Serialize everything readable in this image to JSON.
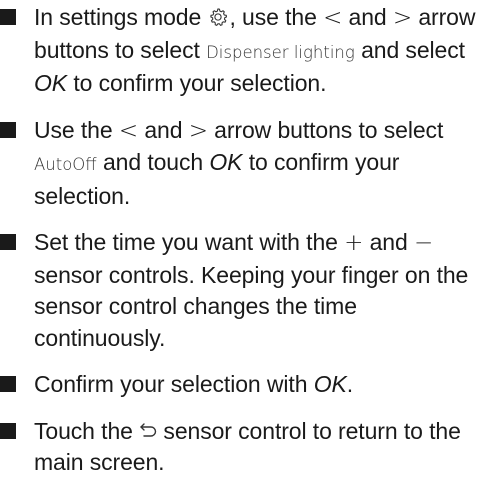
{
  "steps": [
    {
      "t1": "In settings mode ",
      "gear_icon": "gear-icon",
      "t2": ", use the ",
      "lt": "<",
      "t3": " and ",
      "gt": ">",
      "t4": " arrow buttons to select ",
      "display": "Dispenser lighting",
      "t5": " and select ",
      "ok": "OK",
      "t6": " to confirm your selection."
    },
    {
      "t1": "Use the ",
      "lt": "<",
      "t2": " and ",
      "gt": ">",
      "t3": " arrow buttons to select ",
      "display": "AutoOff",
      "t4": " and touch ",
      "ok": "OK",
      "t5": " to confirm your selection."
    },
    {
      "t1": "Set the time you want with the ",
      "plus": "+",
      "t2": " and ",
      "minus": "−",
      "t3": " sensor controls. Keeping your finger on the sensor control changes the time continuously."
    },
    {
      "t1": "Confirm your selection with ",
      "ok": "OK",
      "t2": "."
    },
    {
      "t1": "Touch the ",
      "return_icon": "return-icon",
      "t2": " sensor control to return to the main screen."
    }
  ]
}
